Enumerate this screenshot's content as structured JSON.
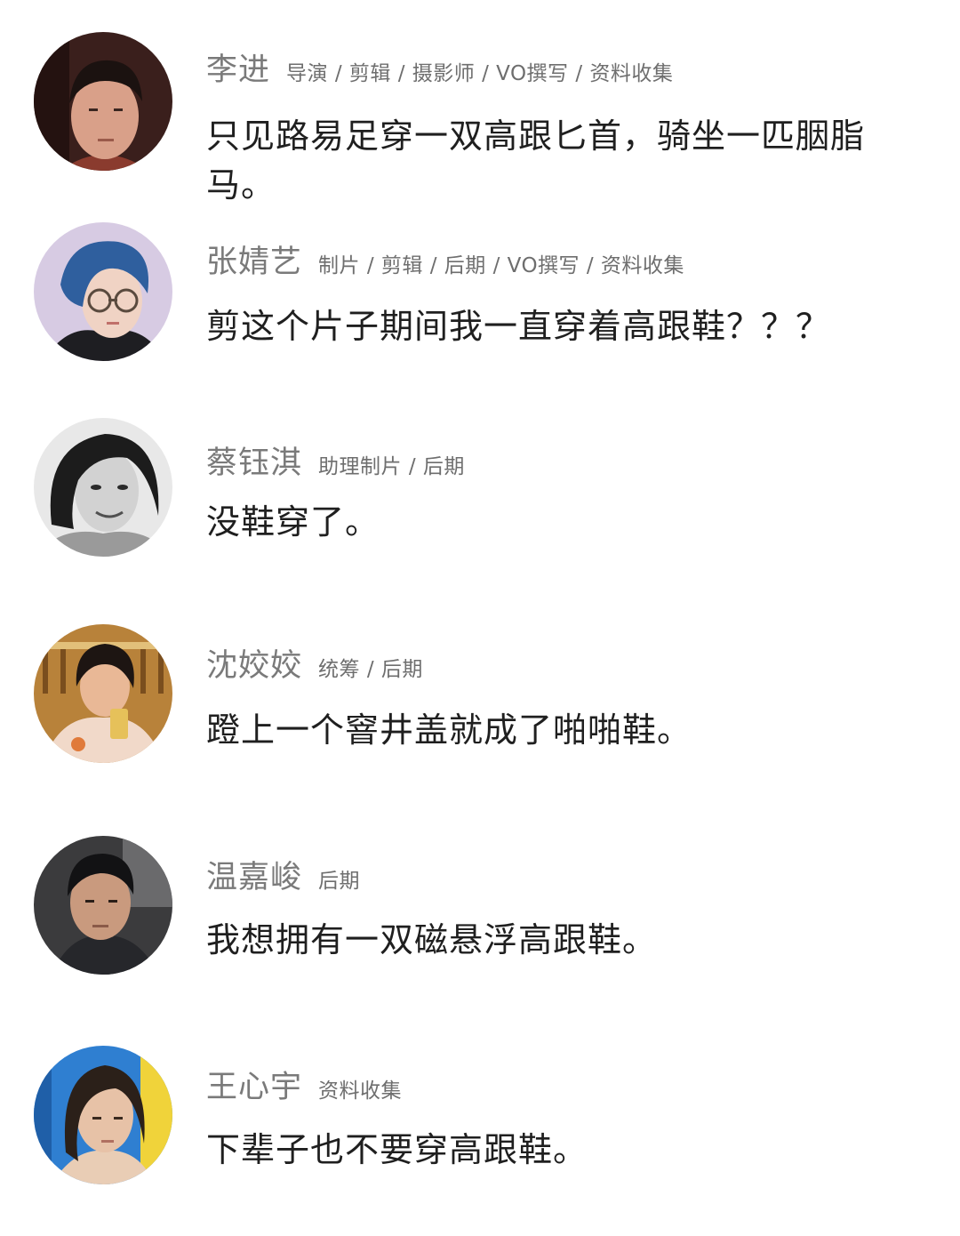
{
  "entries": [
    {
      "name": "李进",
      "roles": "导演 / 剪辑 / 摄影师  / VO撰写 / 资料收集",
      "quote": "只见路易足穿一双高跟匕首，骑坐一匹胭脂马。",
      "avatar_colors": {
        "bg": "#3a1f1c",
        "face": "#d9a089",
        "hair": "#1b1210",
        "shirt": "#8a3b2e"
      }
    },
    {
      "name": "张婧艺",
      "roles": "制片 / 剪辑 / 后期 /  VO撰写 / 资料收集",
      "quote": "剪这个片子期间我一直穿着高跟鞋？？？",
      "avatar_colors": {
        "bg": "#d7cbe3",
        "face": "#f0d3c4",
        "hair": "#2f5f9e",
        "shirt": "#1e1e22"
      }
    },
    {
      "name": "蔡钰淇",
      "roles": "助理制片 / 后期",
      "quote": "没鞋穿了。",
      "avatar_colors": {
        "bg": "#e8e8e8",
        "face": "#d2d2d2",
        "hair": "#1c1c1c",
        "shirt": "#9a9a9a"
      }
    },
    {
      "name": "沈姣姣",
      "roles": "统筹 / 后期",
      "quote": "蹬上一个窨井盖就成了啪啪鞋。",
      "avatar_colors": {
        "bg": "#b8823a",
        "face": "#e9b896",
        "hair": "#1d1512",
        "shirt": "#f1d9c9"
      }
    },
    {
      "name": "温嘉峻",
      "roles": "后期",
      "quote": "我想拥有一双磁悬浮高跟鞋。",
      "avatar_colors": {
        "bg": "#3b3b3d",
        "face": "#c99a7e",
        "hair": "#121214",
        "shirt": "#26272b"
      }
    },
    {
      "name": "王心宇",
      "roles": "资料收集",
      "quote": "下辈子也不要穿高跟鞋。",
      "avatar_colors": {
        "bg": "#2f7fd1",
        "face": "#e7c2a7",
        "hair": "#2b2019",
        "shirt": "#e9cdb5"
      }
    }
  ]
}
